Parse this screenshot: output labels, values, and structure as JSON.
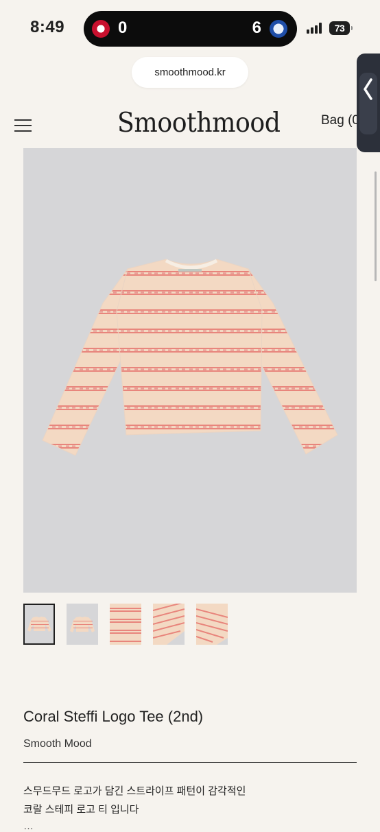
{
  "status_bar": {
    "time": "8:49",
    "live_activity": {
      "home_score": "0",
      "away_score": "6"
    },
    "battery_level": "73"
  },
  "browser": {
    "url": "smoothmood.kr"
  },
  "header": {
    "brand": "Smoothmood",
    "bag_label": "Bag (0"
  },
  "gallery": {
    "thumbnail_count": 5,
    "selected_index": 0
  },
  "product": {
    "title": "Coral Steffi Logo Tee (2nd)",
    "brand": "Smooth Mood",
    "description_lines": [
      "스무드무드 로고가 담긴 스트라이프 패턴이 감각적인",
      "코랄 스테피 로고 티 입니다",
      "…"
    ]
  },
  "colors": {
    "background": "#f6f3ee",
    "image_background": "#d6d6d8",
    "tee_base": "#f3d9c3",
    "tee_stripe": "#e8857c",
    "dark": "#1f1f1f"
  }
}
